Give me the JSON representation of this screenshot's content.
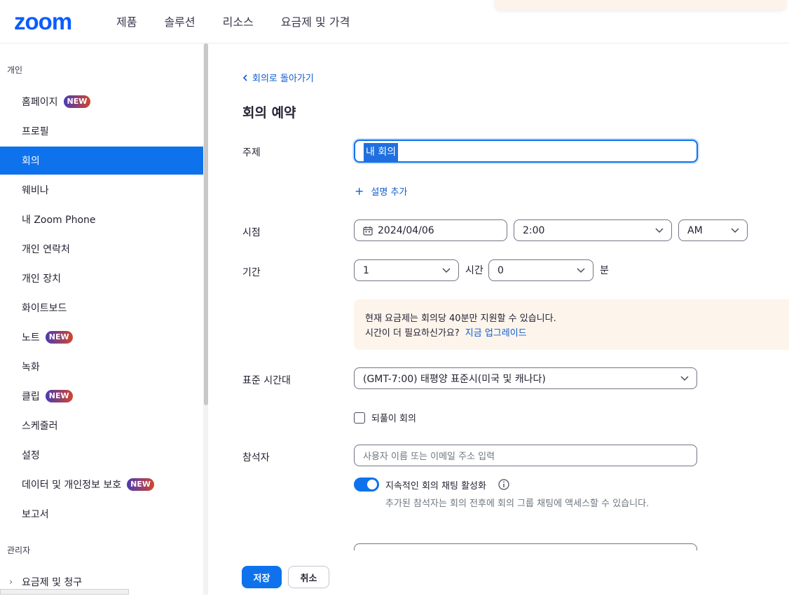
{
  "header": {
    "logo": "zoom",
    "nav": [
      "제품",
      "솔루션",
      "리소스",
      "요금제 및 가격"
    ]
  },
  "sidebar": {
    "personal_title": "개인",
    "items": [
      {
        "label": "홈페이지",
        "badge": "NEW"
      },
      {
        "label": "프로필"
      },
      {
        "label": "회의",
        "active": true
      },
      {
        "label": "웨비나"
      },
      {
        "label": "내 Zoom Phone"
      },
      {
        "label": "개인 연락처"
      },
      {
        "label": "개인 장치"
      },
      {
        "label": "화이트보드"
      },
      {
        "label": "노트",
        "badge": "NEW"
      },
      {
        "label": "녹화"
      },
      {
        "label": "클립",
        "badge": "NEW"
      },
      {
        "label": "스케줄러"
      },
      {
        "label": "설정"
      },
      {
        "label": "데이터 및 개인정보 보호",
        "badge": "NEW"
      },
      {
        "label": "보고서"
      }
    ],
    "admin_title": "관리자",
    "admin_items": [
      {
        "label": "요금제 및 청구"
      }
    ]
  },
  "main": {
    "back_link": "회의로 돌아가기",
    "title": "회의 예약",
    "topic": {
      "label": "주제",
      "value": "내 회의"
    },
    "add_description": "설명 추가",
    "when": {
      "label": "시점",
      "date": "2024/04/06",
      "time": "2:00",
      "ampm": "AM"
    },
    "duration": {
      "label": "기간",
      "hours": "1",
      "hours_unit": "시간",
      "minutes": "0",
      "minutes_unit": "분"
    },
    "notice": {
      "line1": "현재 요금제는 회의당 40분만 지원할 수 있습니다.",
      "line2": "시간이 더 필요하신가요?",
      "link": "지금 업그레이드"
    },
    "timezone": {
      "label": "표준 시간대",
      "value": "(GMT-7:00) 태평양 표준시(미국 및 캐나다)"
    },
    "recurring": {
      "label": "되풀이 회의",
      "checked": false
    },
    "attendees": {
      "label": "참석자",
      "placeholder": "사용자 이름 또는 이메일 주소 입력"
    },
    "chat_toggle": {
      "label": "지속적인 회의 채팅 활성화",
      "enabled": true,
      "description": "추가된 참석자는 회의 전후에 회의 그룹 채팅에 액세스할 수 있습니다."
    },
    "save_label": "저장",
    "cancel_label": "취소"
  },
  "colors": {
    "brand": "#0b5cff",
    "accent": "#0e72ed",
    "link": "#0e5ccf",
    "notice_bg": "#fdf4ec"
  }
}
